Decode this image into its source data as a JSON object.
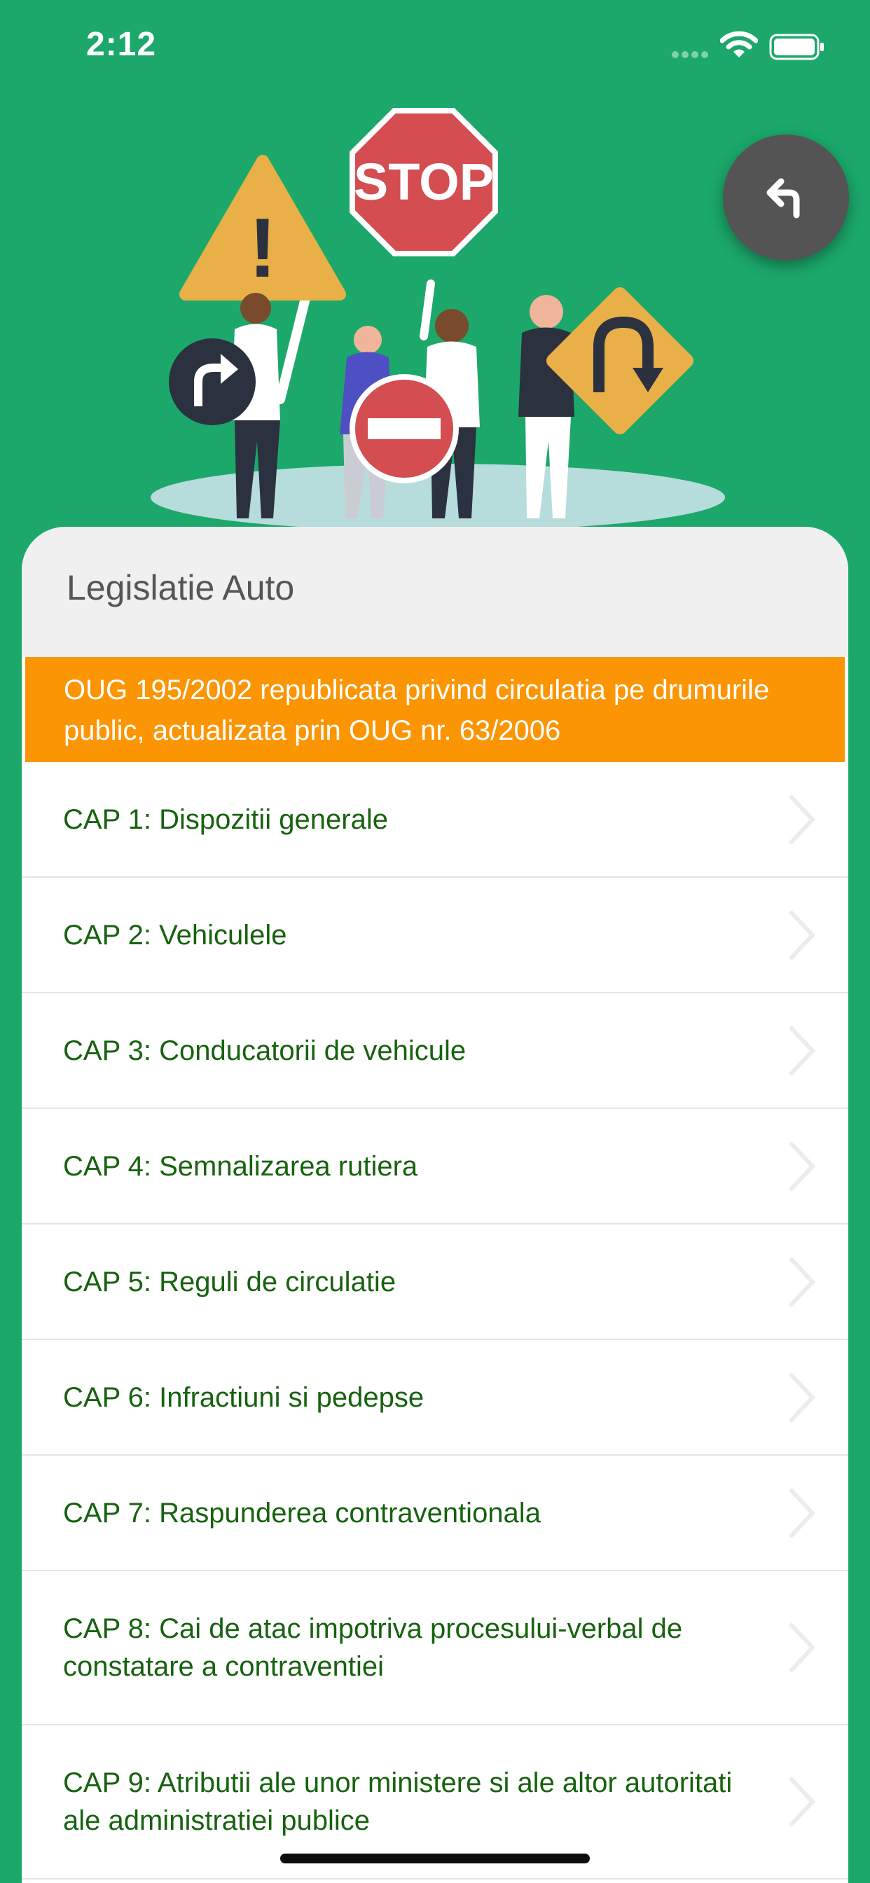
{
  "status_bar": {
    "time": "2:12",
    "icons": [
      "signal-dots-icon",
      "wifi-icon",
      "battery-icon"
    ]
  },
  "hero": {
    "illustration": "people holding traffic signs",
    "signs": [
      "warning-sign",
      "stop-sign",
      "no-entry-sign",
      "turn-right-sign",
      "u-turn-sign"
    ],
    "stop_text": "STOP",
    "warning_text": "!"
  },
  "back_button": {
    "icon": "undo-arrow-icon"
  },
  "card": {
    "title": "Legislatie Auto",
    "section": "OUG 195/2002 republicata privind circulatia pe drumurile public, actualizata prin OUG nr. 63/2006",
    "chapters": [
      {
        "label": "CAP 1: Dispozitii generale"
      },
      {
        "label": "CAP 2: Vehiculele"
      },
      {
        "label": "CAP 3: Conducatorii de vehicule"
      },
      {
        "label": "CAP 4: Semnalizarea rutiera"
      },
      {
        "label": "CAP 5: Reguli de circulatie"
      },
      {
        "label": "CAP 6: Infractiuni si pedepse"
      },
      {
        "label": "CAP 7: Raspunderea contraventionala"
      },
      {
        "label": "CAP 8: Cai de atac impotriva procesului-verbal de constatare a contraventiei"
      },
      {
        "label": "CAP 9: Atributii ale unor ministere si ale altor autoritati ale administratiei publice"
      }
    ]
  },
  "colors": {
    "background": "#1ba86a",
    "banner": "#fc9504",
    "chapter_text": "#17620f",
    "fab": "#545454",
    "header_bg": "#f0f0f0"
  }
}
